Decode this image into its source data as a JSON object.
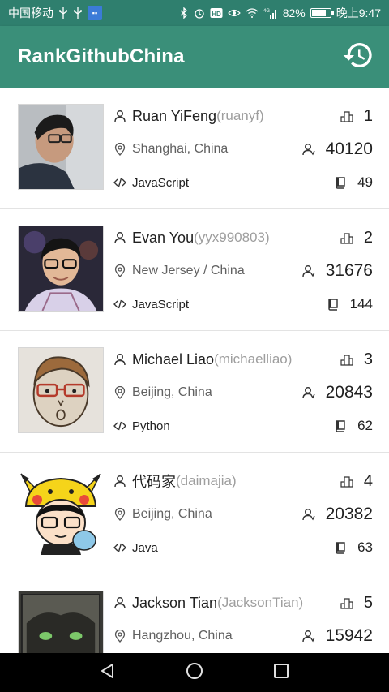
{
  "status_bar": {
    "carrier": "中国移动",
    "battery_percent": "82%",
    "battery_level": 0.82,
    "time": "晚上9:47",
    "signal_label": "4G"
  },
  "app": {
    "title": "RankGithubChina",
    "colors": {
      "primary": "#3a8f79",
      "status": "#2f7f6e",
      "divider": "#e3e3e3"
    }
  },
  "users": [
    {
      "name": "Ruan YiFeng",
      "login": "(ruanyf)",
      "rank": "1",
      "location": "Shanghai, China",
      "followers": "40120",
      "language": "JavaScript",
      "repos": "49"
    },
    {
      "name": "Evan You",
      "login": "(yyx990803)",
      "rank": "2",
      "location": "New Jersey / China",
      "followers": "31676",
      "language": "JavaScript",
      "repos": "144"
    },
    {
      "name": "Michael Liao",
      "login": "(michaelliao)",
      "rank": "3",
      "location": "Beijing, China",
      "followers": "20843",
      "language": "Python",
      "repos": "62"
    },
    {
      "name": "代码家",
      "login": "(daimajia)",
      "rank": "4",
      "location": "Beijing, China",
      "followers": "20382",
      "language": "Java",
      "repos": "63"
    },
    {
      "name": "Jackson Tian",
      "login": "(JacksonTian)",
      "rank": "5",
      "location": "Hangzhou, China",
      "followers": "15942",
      "language": "",
      "repos": ""
    }
  ],
  "icons": {
    "user": "person-icon",
    "rank": "rank-podium-icon",
    "location": "location-pin-icon",
    "followers": "followers-icon",
    "language": "code-icon",
    "repos": "repository-book-icon",
    "history": "history-icon"
  }
}
